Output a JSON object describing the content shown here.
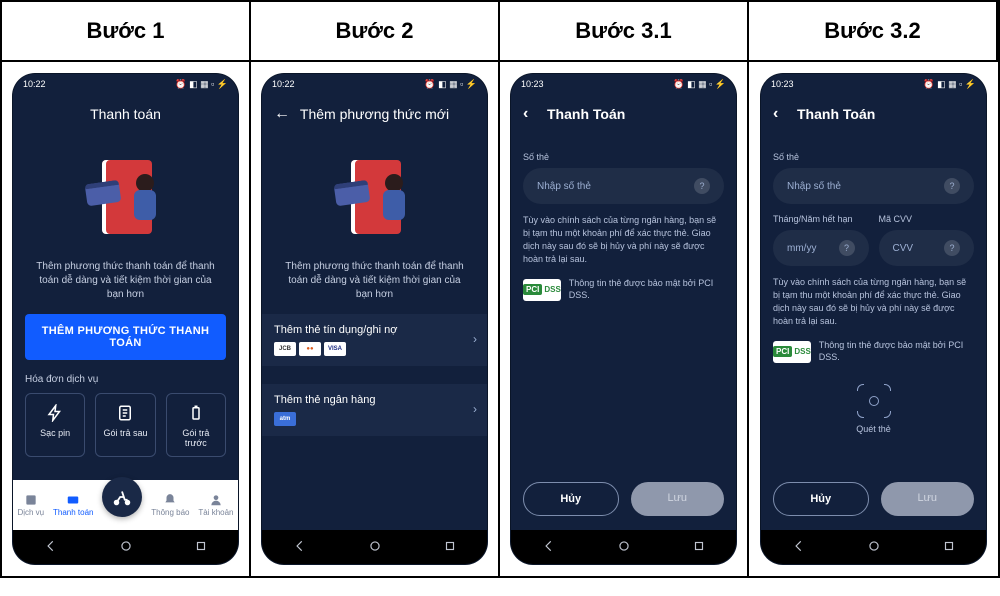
{
  "headers": [
    "Bước 1",
    "Bước 2",
    "Bước 3.1",
    "Bước 3.2"
  ],
  "status_time_a": "10:22",
  "status_time_b": "10:23",
  "step1": {
    "appbar_title": "Thanh toán",
    "caption": "Thêm phương thức thanh toán để thanh toán dễ dàng và tiết kiệm thời gian của bạn hơn",
    "primary_btn": "THÊM PHƯƠNG THỨC THANH TOÁN",
    "section_label": "Hóa đơn dịch vụ",
    "chips": [
      "Sạc pin",
      "Gói trả sau",
      "Gói trả trước"
    ],
    "nav": [
      "Dịch vụ",
      "Thanh toán",
      "",
      "Thông báo",
      "Tài khoản"
    ]
  },
  "step2": {
    "appbar_title": "Thêm phương thức mới",
    "caption": "Thêm phương thức thanh toán để thanh toán dễ dàng và tiết kiệm thời gian của bạn hơn",
    "row1_title": "Thêm thẻ tín dụng/ghi nợ",
    "row2_title": "Thêm thẻ ngân hàng"
  },
  "step3": {
    "appbar_title": "Thanh Toán",
    "card_label": "Số thẻ",
    "card_placeholder": "Nhập số thẻ",
    "expiry_label": "Tháng/Năm hết hạn",
    "expiry_placeholder": "mm/yy",
    "cvv_label": "Mã CVV",
    "cvv_placeholder": "CVV",
    "note": "Tùy vào chính sách của từng ngân hàng, bạn sẽ bị tạm thu một khoản phí để xác thực thẻ. Giao dịch này sau đó sẽ bị hủy và phí này sẽ được hoàn trả lại sau.",
    "pci_text": "Thông tin thẻ được bảo mật bởi PCI DSS.",
    "scan_label": "Quét thẻ",
    "cancel": "Hủy",
    "save": "Lưu"
  }
}
